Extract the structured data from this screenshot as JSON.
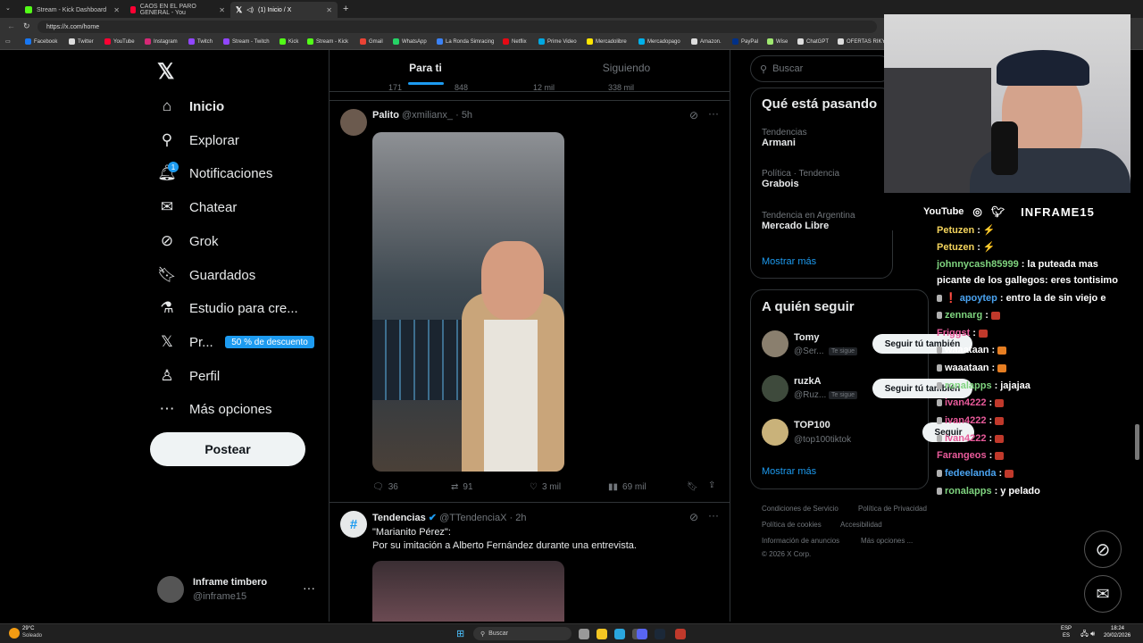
{
  "browser": {
    "tabs": [
      {
        "title": "Stream - Kick Dashboard",
        "color": "#53fc18"
      },
      {
        "title": "CAOS EN EL PARO GENERAL - You",
        "color": "#ff0033"
      },
      {
        "title": "(1) Inicio / X",
        "color": "#ffffff"
      }
    ],
    "url": "https://x.com/home",
    "bookmarks": [
      "Facebook",
      "Twitter",
      "YouTube",
      "Instagram",
      "Twitch",
      "Stream - Twitch",
      "Kick",
      "Stream - Kick",
      "Gmail",
      "WhatsApp",
      "La Ronda Simracing",
      "Netflix",
      "Prime Video",
      "Mercadolibre",
      "Mercadopago",
      "Amazon.",
      "PayPal",
      "Wise",
      "ChatGPT",
      "OFERTAS RIKY S"
    ]
  },
  "nav": {
    "items": [
      {
        "label": "Inicio",
        "icon": "home-icon"
      },
      {
        "label": "Explorar",
        "icon": "search-icon"
      },
      {
        "label": "Notificaciones",
        "icon": "bell-icon",
        "badge": "1"
      },
      {
        "label": "Chatear",
        "icon": "mail-icon"
      },
      {
        "label": "Grok",
        "icon": "grok-icon"
      },
      {
        "label": "Guardados",
        "icon": "bookmark-icon"
      },
      {
        "label": "Estudio para cre...",
        "icon": "flask-icon"
      },
      {
        "label": "Pr...",
        "icon": "x-icon"
      },
      {
        "label": "Perfil",
        "icon": "person-icon"
      },
      {
        "label": "Más opciones",
        "icon": "more-circle-icon"
      }
    ],
    "promo": "50 % de descuento",
    "post_button": "Postear",
    "account": {
      "name": "Inframe timbero",
      "handle": "@inframe15"
    }
  },
  "feed": {
    "tabs": [
      "Para ti",
      "Siguiendo"
    ],
    "ghost_counts": [
      "171",
      "848",
      "12 mil",
      "338 mil"
    ],
    "tweet1": {
      "name": "Palito",
      "handle": "@xmilianx_",
      "time": "· 5h",
      "stats": {
        "replies": "36",
        "retweets": "91",
        "likes": "3 mil",
        "views": "69 mil"
      }
    },
    "tweet2": {
      "name": "Tendencias",
      "handle": "@TTendenciaX",
      "time": "· 2h",
      "line1": "\"Marianito Pérez\":",
      "line2": "Por su imitación a Alberto Fernández durante una entrevista."
    }
  },
  "right": {
    "search_placeholder": "Buscar",
    "trends_title": "Qué está pasando",
    "trends": [
      {
        "context": "Tendencias",
        "name": "Armani"
      },
      {
        "context": "Política · Tendencia",
        "name": "Grabois"
      },
      {
        "context": "Tendencia en Argentina",
        "name": "Mercado Libre"
      }
    ],
    "show_more": "Mostrar más",
    "follow_title": "A quién seguir",
    "follow": [
      {
        "name": "Tomy",
        "handle": "@Ser...",
        "tag": "Te sigue",
        "button": "Seguir tú también"
      },
      {
        "name": "ruzkA",
        "handle": "@Ruz...",
        "tag": "Te sigue",
        "button": "Seguir tú también"
      },
      {
        "name": "TOP100",
        "handle": "@top100tiktok",
        "tag": "",
        "button": "Seguir"
      }
    ],
    "show_more2": "Mostrar más",
    "footer": [
      "Condiciones de Servicio",
      "Política de Privacidad",
      "Política de cookies",
      "Accesibilidad",
      "Información de anuncios",
      "Más opciones ...",
      "© 2026 X Corp."
    ]
  },
  "stream": {
    "socials": "YouTube",
    "channel": "INFRAME15",
    "chat": [
      {
        "user": "Petuzen",
        "color": "#f3d35c",
        "msg": ""
      },
      {
        "user": "Petuzen",
        "color": "#f3d35c",
        "msg": ""
      },
      {
        "user": "johnnycash85999",
        "color": "#7fd47f",
        "msg": "la puteada mas"
      },
      {
        "user": "",
        "color": "#ffffff",
        "msg": "picante de los gallegos: eres tontisimo"
      },
      {
        "user": "apoytep",
        "color": "#4aa3f0",
        "msg": "entro la de sin viejo e"
      },
      {
        "user": "zennarg",
        "color": "#7fd47f",
        "msg": ""
      },
      {
        "user": "Friggst",
        "color": "#e85a9a",
        "msg": ""
      },
      {
        "user": "waaataan",
        "color": "#ffffff",
        "msg": ""
      },
      {
        "user": "waaataan",
        "color": "#ffffff",
        "msg": ""
      },
      {
        "user": "ronalapps",
        "color": "#7fd47f",
        "msg": "jajajaa"
      },
      {
        "user": "ivan4222",
        "color": "#e85a9a",
        "msg": ""
      },
      {
        "user": "ivan4222",
        "color": "#e85a9a",
        "msg": ""
      },
      {
        "user": "ivan4222",
        "color": "#e85a9a",
        "msg": ""
      },
      {
        "user": "Farangeos",
        "color": "#e85a9a",
        "msg": ""
      },
      {
        "user": "fedeelanda",
        "color": "#4aa3f0",
        "msg": ""
      },
      {
        "user": "ronalapps",
        "color": "#7fd47f",
        "msg": "y pelado"
      }
    ]
  },
  "taskbar": {
    "weather_temp": "29°C",
    "weather_desc": "Soleado",
    "search": "Buscar",
    "lang1": "ESP",
    "lang2": "ES",
    "time": "18:24",
    "date": "20/02/2026"
  }
}
